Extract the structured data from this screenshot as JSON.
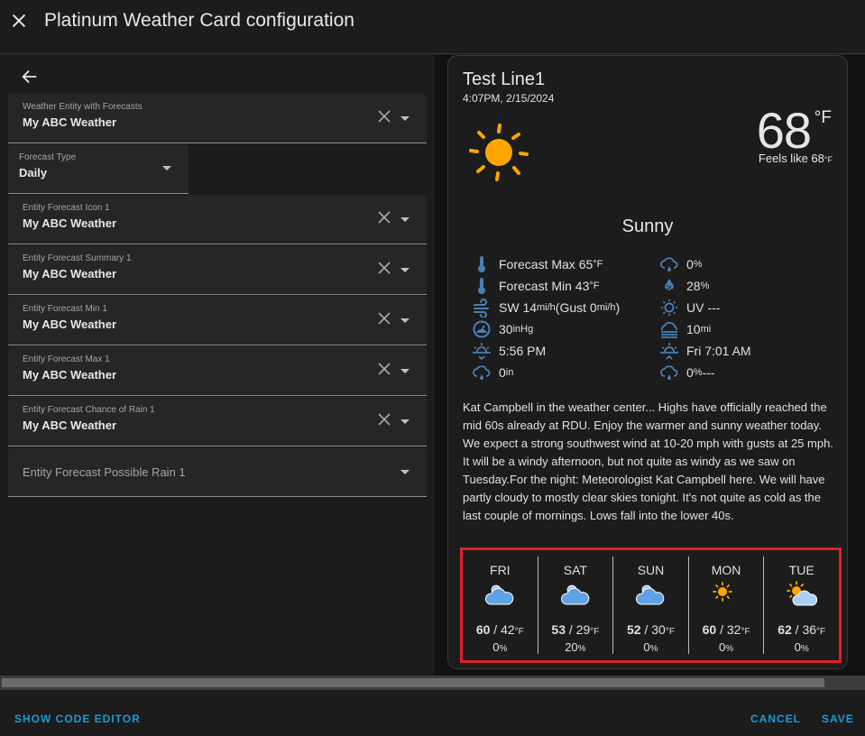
{
  "dialog": {
    "title": "Platinum Weather Card configuration",
    "icons": {
      "close": "close-icon",
      "back": "arrow-left-icon"
    }
  },
  "editor": {
    "fields": [
      {
        "label": "Weather Entity with Forecasts",
        "value": "My ABC Weather",
        "clearable": true
      },
      {
        "label": "Forecast Type",
        "value": "Daily",
        "clearable": false
      },
      {
        "label": "Entity Forecast Icon 1",
        "value": "My ABC Weather",
        "clearable": true
      },
      {
        "label": "Entity Forecast Summary 1",
        "value": "My ABC Weather",
        "clearable": true
      },
      {
        "label": "Entity Forecast Min 1",
        "value": "My ABC Weather",
        "clearable": true
      },
      {
        "label": "Entity Forecast Max 1",
        "value": "My ABC Weather",
        "clearable": true
      },
      {
        "label": "Entity Forecast Chance of Rain 1",
        "value": "My ABC Weather",
        "clearable": true
      },
      {
        "label": "Entity Forecast Possible Rain 1",
        "value": "",
        "clearable": false
      }
    ]
  },
  "preview": {
    "title": "Test Line1",
    "datetime": "4:07PM, 2/15/2024",
    "temperature": "68",
    "temperature_unit": "°F",
    "feels_like_label": "Feels like 68",
    "feels_like_unit": "°F",
    "condition": "Sunny",
    "current_icon": "sunny-icon",
    "attributes_left": [
      {
        "icon": "thermometer-icon",
        "text": "Forecast Max 65",
        "unit": "°F"
      },
      {
        "icon": "thermometer-icon",
        "text": "Forecast Min 43",
        "unit": "°F"
      },
      {
        "icon": "wind-icon",
        "text": "SW 14",
        "unit": "mi/h",
        "text2": " (Gust 0",
        "unit2": "mi/h",
        "text3": ")"
      },
      {
        "icon": "gauge-icon",
        "text": "30",
        "unit": "inHg"
      },
      {
        "icon": "sunset-icon",
        "text": "5:56 PM",
        "unit": ""
      },
      {
        "icon": "rain-cloud-icon",
        "text": "0",
        "unit": "in"
      }
    ],
    "attributes_right": [
      {
        "icon": "rain-cloud-icon",
        "text": "0",
        "unit": "%"
      },
      {
        "icon": "humidity-icon",
        "text": "28",
        "unit": "%"
      },
      {
        "icon": "uv-icon",
        "text": "UV ---",
        "unit": ""
      },
      {
        "icon": "visibility-icon",
        "text": "10",
        "unit": "mi"
      },
      {
        "icon": "sunrise-icon",
        "text": "Fri 7:01 AM",
        "unit": ""
      },
      {
        "icon": "rain-cloud-icon",
        "text": "0",
        "unit": "%",
        "text2": " ---"
      }
    ],
    "summary": "Kat Campbell in the weather center... Highs have officially reached the mid 60s already at RDU. Enjoy the warmer and sunny weather today. We expect a strong southwest wind at 10-20 mph with gusts at 25 mph. It will be a windy afternoon, but not quite as windy as we saw on Tuesday.For the night: Meteorologist Kat Campbell here. We will have partly cloudy to mostly clear skies tonight. It's not quite as cold as the last couple of mornings. Lows fall into the lower 40s.",
    "forecast": [
      {
        "day": "FRI",
        "icon": "cloudy-icon",
        "high": "60",
        "low": "42",
        "unit": "°F",
        "rain": "0",
        "rain_unit": "%"
      },
      {
        "day": "SAT",
        "icon": "cloudy-icon",
        "high": "53",
        "low": "29",
        "unit": "°F",
        "rain": "20",
        "rain_unit": "%"
      },
      {
        "day": "SUN",
        "icon": "cloudy-icon",
        "high": "52",
        "low": "30",
        "unit": "°F",
        "rain": "0",
        "rain_unit": "%"
      },
      {
        "day": "MON",
        "icon": "sunny-icon",
        "high": "60",
        "low": "32",
        "unit": "°F",
        "rain": "0",
        "rain_unit": "%"
      },
      {
        "day": "TUE",
        "icon": "partly-cloudy-icon",
        "high": "62",
        "low": "36",
        "unit": "°F",
        "rain": "0",
        "rain_unit": "%"
      }
    ],
    "highlight_color": "#e0202a",
    "icon_color": "#4a7fb5",
    "sun_color": "#ffa500"
  },
  "footer": {
    "show_code_editor": "SHOW CODE EDITOR",
    "cancel": "CANCEL",
    "save": "SAVE",
    "accent_color": "#1d9bd9"
  }
}
